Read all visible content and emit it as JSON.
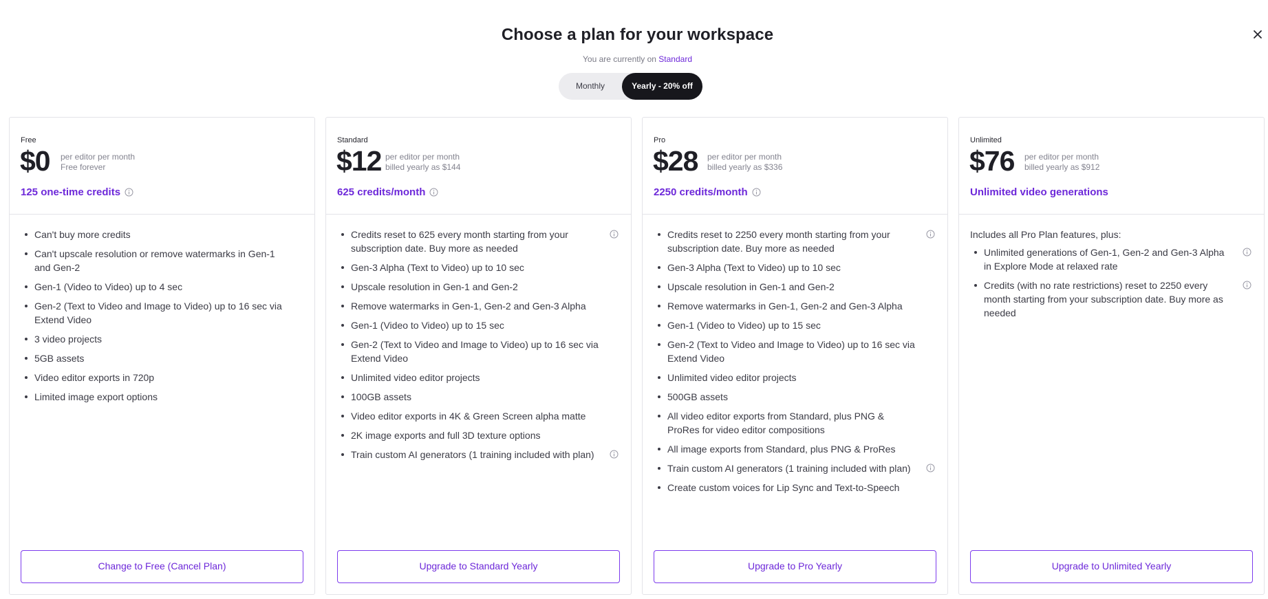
{
  "header": {
    "title": "Choose a plan for your workspace",
    "subtitle_prefix": "You are currently on ",
    "current_plan": "Standard",
    "close_icon": "close-icon"
  },
  "billing_toggle": {
    "monthly_label": "Monthly",
    "yearly_label": "Yearly - 20% off",
    "selected": "yearly"
  },
  "colors": {
    "accent": "#6d28d9",
    "toggle_active_bg": "#17171c"
  },
  "plans": [
    {
      "name": "Free",
      "price": "$0",
      "price_note_1": "per editor per month",
      "price_note_2": "Free forever",
      "credits": "125 one-time credits",
      "credits_info": true,
      "intro": "",
      "features": [
        {
          "text": "Can't buy more credits",
          "info": false
        },
        {
          "text": "Can't upscale resolution or remove watermarks in Gen-1 and Gen-2",
          "info": false
        },
        {
          "text": "Gen-1 (Video to Video) up to 4 sec",
          "info": false
        },
        {
          "text": "Gen-2 (Text to Video and Image to Video) up to 16 sec via Extend Video",
          "info": false
        },
        {
          "text": "3 video projects",
          "info": false
        },
        {
          "text": "5GB assets",
          "info": false
        },
        {
          "text": "Video editor exports in 720p",
          "info": false
        },
        {
          "text": "Limited image export options",
          "info": false
        }
      ],
      "cta": "Change to Free (Cancel Plan)"
    },
    {
      "name": "Standard",
      "price": "$12",
      "price_note_1": "per editor per month",
      "price_note_2": "billed yearly as $144",
      "credits": "625 credits/month",
      "credits_info": true,
      "intro": "",
      "features": [
        {
          "text": "Credits reset to 625 every month starting from your subscription date. Buy more as needed",
          "info": true
        },
        {
          "text": "Gen-3 Alpha (Text to Video) up to 10 sec",
          "info": false
        },
        {
          "text": "Upscale resolution in Gen-1 and Gen-2",
          "info": false
        },
        {
          "text": "Remove watermarks in Gen-1, Gen-2 and Gen-3 Alpha",
          "info": false
        },
        {
          "text": "Gen-1 (Video to Video) up to 15 sec",
          "info": false
        },
        {
          "text": "Gen-2 (Text to Video and Image to Video) up to 16 sec via Extend Video",
          "info": false
        },
        {
          "text": "Unlimited video editor projects",
          "info": false
        },
        {
          "text": "100GB assets",
          "info": false
        },
        {
          "text": "Video editor exports in 4K & Green Screen alpha matte",
          "info": false
        },
        {
          "text": "2K image exports and full 3D texture options",
          "info": false
        },
        {
          "text": "Train custom AI generators (1 training included with plan)",
          "info": true
        }
      ],
      "cta": "Upgrade to Standard Yearly"
    },
    {
      "name": "Pro",
      "price": "$28",
      "price_note_1": "per editor per month",
      "price_note_2": "billed yearly as $336",
      "credits": "2250 credits/month",
      "credits_info": true,
      "intro": "",
      "features": [
        {
          "text": "Credits reset to 2250 every month starting from your subscription date. Buy more as needed",
          "info": true
        },
        {
          "text": "Gen-3 Alpha (Text to Video) up to 10 sec",
          "info": false
        },
        {
          "text": "Upscale resolution in Gen-1 and Gen-2",
          "info": false
        },
        {
          "text": "Remove watermarks in Gen-1, Gen-2 and Gen-3 Alpha",
          "info": false
        },
        {
          "text": "Gen-1 (Video to Video) up to 15 sec",
          "info": false
        },
        {
          "text": "Gen-2 (Text to Video and Image to Video) up to 16 sec via Extend Video",
          "info": false
        },
        {
          "text": "Unlimited video editor projects",
          "info": false
        },
        {
          "text": "500GB assets",
          "info": false
        },
        {
          "text": "All video editor exports from Standard, plus PNG & ProRes for video editor compositions",
          "info": false
        },
        {
          "text": "All image exports from Standard, plus PNG & ProRes",
          "info": false
        },
        {
          "text": "Train custom AI generators (1 training included with plan)",
          "info": true
        },
        {
          "text": "Create custom voices for Lip Sync and Text-to-Speech",
          "info": false
        }
      ],
      "cta": "Upgrade to Pro Yearly"
    },
    {
      "name": "Unlimited",
      "price": "$76",
      "price_note_1": "per editor per month",
      "price_note_2": "billed yearly as $912",
      "credits": "Unlimited video generations",
      "credits_info": false,
      "intro": "Includes all Pro Plan features, plus:",
      "features": [
        {
          "text": "Unlimited generations of Gen-1, Gen-2 and Gen-3 Alpha in Explore Mode at relaxed rate",
          "info": true
        },
        {
          "text": "Credits (with no rate restrictions) reset to 2250 every month starting from your subscription date. Buy more as needed",
          "info": true
        }
      ],
      "cta": "Upgrade to Unlimited Yearly"
    }
  ]
}
